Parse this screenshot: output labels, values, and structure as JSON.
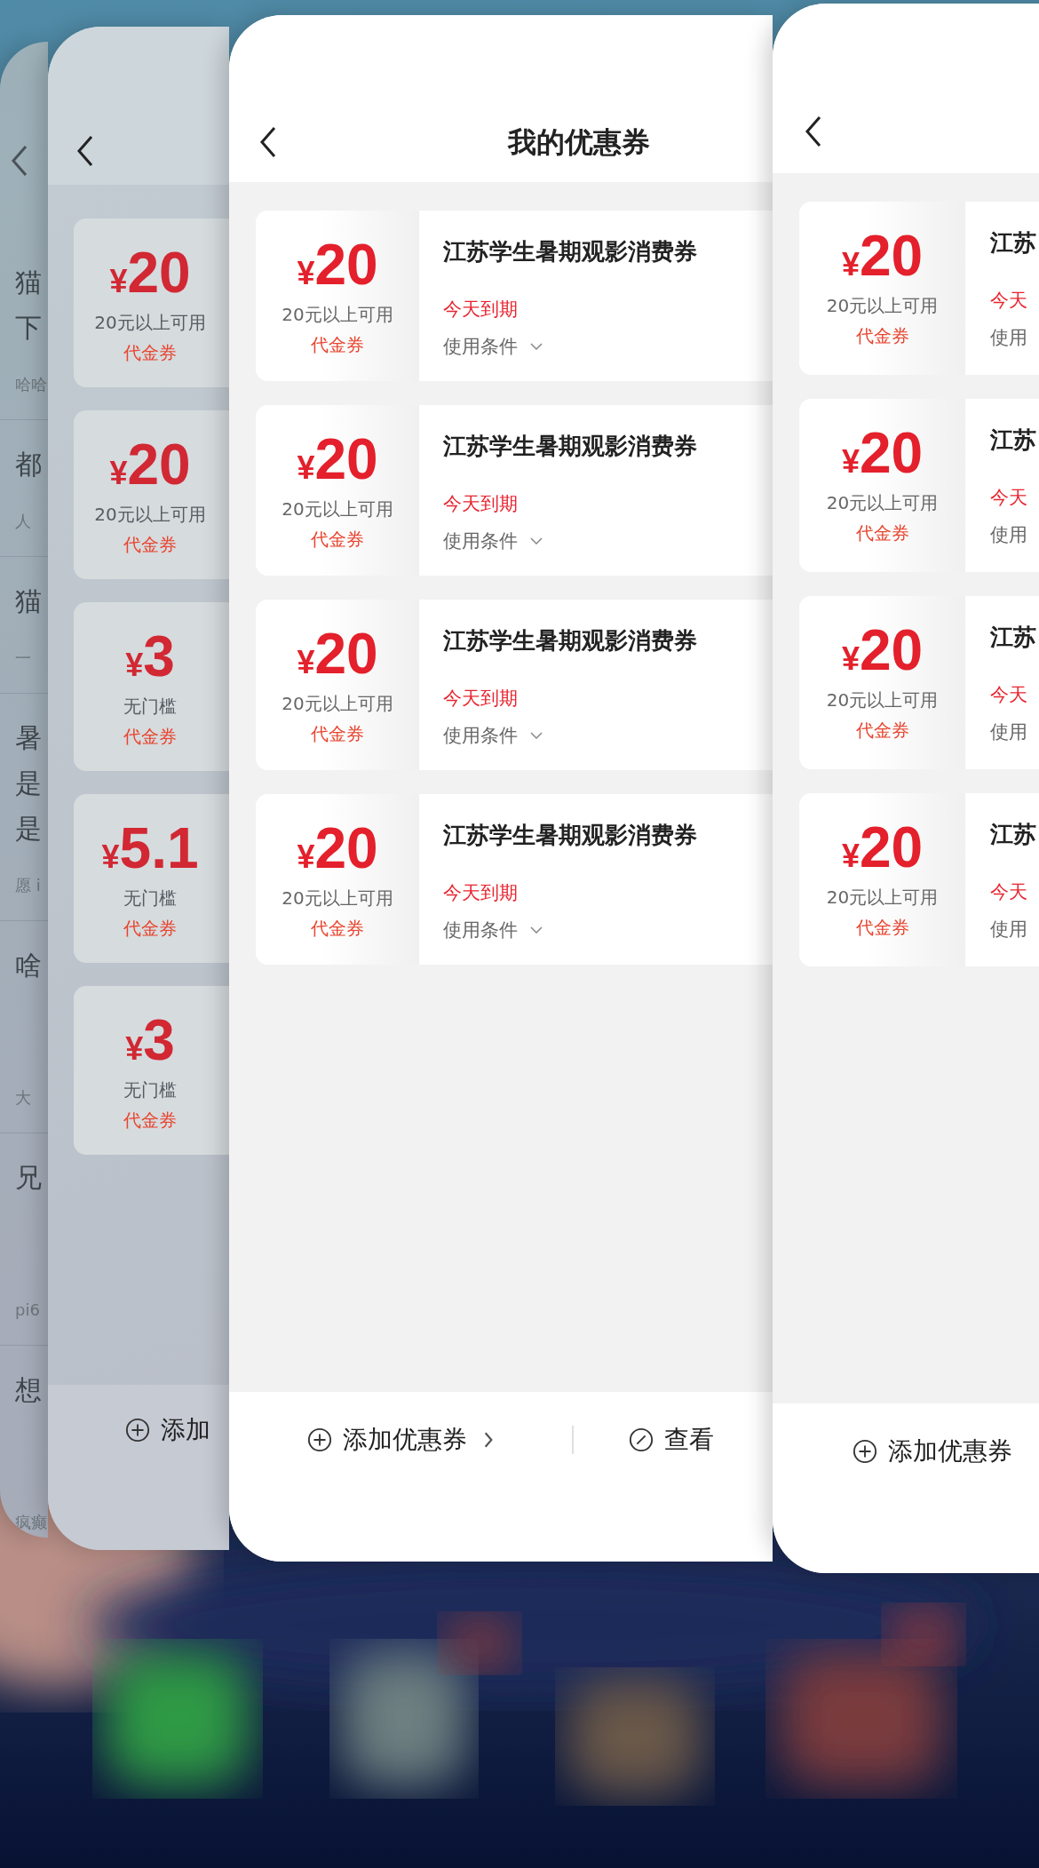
{
  "cards": [
    {
      "kind": "feed",
      "back": true,
      "posts": [
        {
          "kind": "compact",
          "title_lines": [
            "猫",
            "下"
          ],
          "meta": "哈哈"
        },
        {
          "kind": "compact",
          "title_lines": [
            "都"
          ],
          "meta": "人"
        },
        {
          "kind": "compact",
          "title_lines": [
            "猫"
          ],
          "meta": "一"
        },
        {
          "kind": "compact",
          "title_lines": [
            "暑",
            "是",
            "是"
          ],
          "meta": "愿 i"
        },
        {
          "kind": "tall",
          "title_lines": [
            "啥"
          ],
          "meta": "大"
        },
        {
          "kind": "tall",
          "title_lines": [
            "兄"
          ],
          "meta": "pi6"
        },
        {
          "kind": "tall",
          "title_lines": [
            "想"
          ],
          "meta": "疯癫"
        }
      ]
    },
    {
      "kind": "coupons",
      "back": true,
      "coupons": [
        {
          "currency": "¥",
          "amount": "20",
          "rule": "20元以上可用",
          "type": "代金券"
        },
        {
          "currency": "¥",
          "amount": "20",
          "rule": "20元以上可用",
          "type": "代金券"
        },
        {
          "currency": "¥",
          "amount": "3",
          "rule": "无门槛",
          "type": "代金券"
        },
        {
          "currency": "¥",
          "amount": "5.1",
          "rule": "无门槛",
          "type": "代金券"
        },
        {
          "currency": "¥",
          "amount": "3",
          "rule": "无门槛",
          "type": "代金券"
        }
      ],
      "footer": [
        {
          "kind": "add",
          "label": "添加"
        }
      ]
    },
    {
      "kind": "coupons",
      "back": true,
      "title": "我的优惠券",
      "coupons": [
        {
          "currency": "¥",
          "amount": "20",
          "rule": "20元以上可用",
          "type": "代金券",
          "name": "江苏学生暑期观影消费券",
          "expiry": "今天到期",
          "conditions": "使用条件",
          "expanded": false
        },
        {
          "currency": "¥",
          "amount": "20",
          "rule": "20元以上可用",
          "type": "代金券",
          "name": "江苏学生暑期观影消费券",
          "expiry": "今天到期",
          "conditions": "使用条件",
          "expanded": false
        },
        {
          "currency": "¥",
          "amount": "20",
          "rule": "20元以上可用",
          "type": "代金券",
          "name": "江苏学生暑期观影消费券",
          "expiry": "今天到期",
          "conditions": "使用条件",
          "expanded": false
        },
        {
          "currency": "¥",
          "amount": "20",
          "rule": "20元以上可用",
          "type": "代金券",
          "name": "江苏学生暑期观影消费券",
          "expiry": "今天到期",
          "conditions": "使用条件",
          "expanded": false
        }
      ],
      "footer": [
        {
          "kind": "add",
          "label": "添加优惠券",
          "chevron": true
        },
        {
          "kind": "view",
          "label": "查看"
        }
      ]
    },
    {
      "kind": "coupons",
      "back": true,
      "coupons": [
        {
          "currency": "¥",
          "amount": "20",
          "rule": "20元以上可用",
          "type": "代金券",
          "name": "江苏",
          "expiry": "今天",
          "conditions": "使用"
        },
        {
          "currency": "¥",
          "amount": "20",
          "rule": "20元以上可用",
          "type": "代金券",
          "name": "江苏",
          "expiry": "今天",
          "conditions": "使用"
        },
        {
          "currency": "¥",
          "amount": "20",
          "rule": "20元以上可用",
          "type": "代金券",
          "name": "江苏",
          "expiry": "今天",
          "conditions": "使用"
        },
        {
          "currency": "¥",
          "amount": "20",
          "rule": "20元以上可用",
          "type": "代金券",
          "name": "江苏",
          "expiry": "今天",
          "conditions": "使用"
        }
      ],
      "footer": [
        {
          "kind": "add",
          "label": "添加优惠券"
        }
      ]
    }
  ]
}
